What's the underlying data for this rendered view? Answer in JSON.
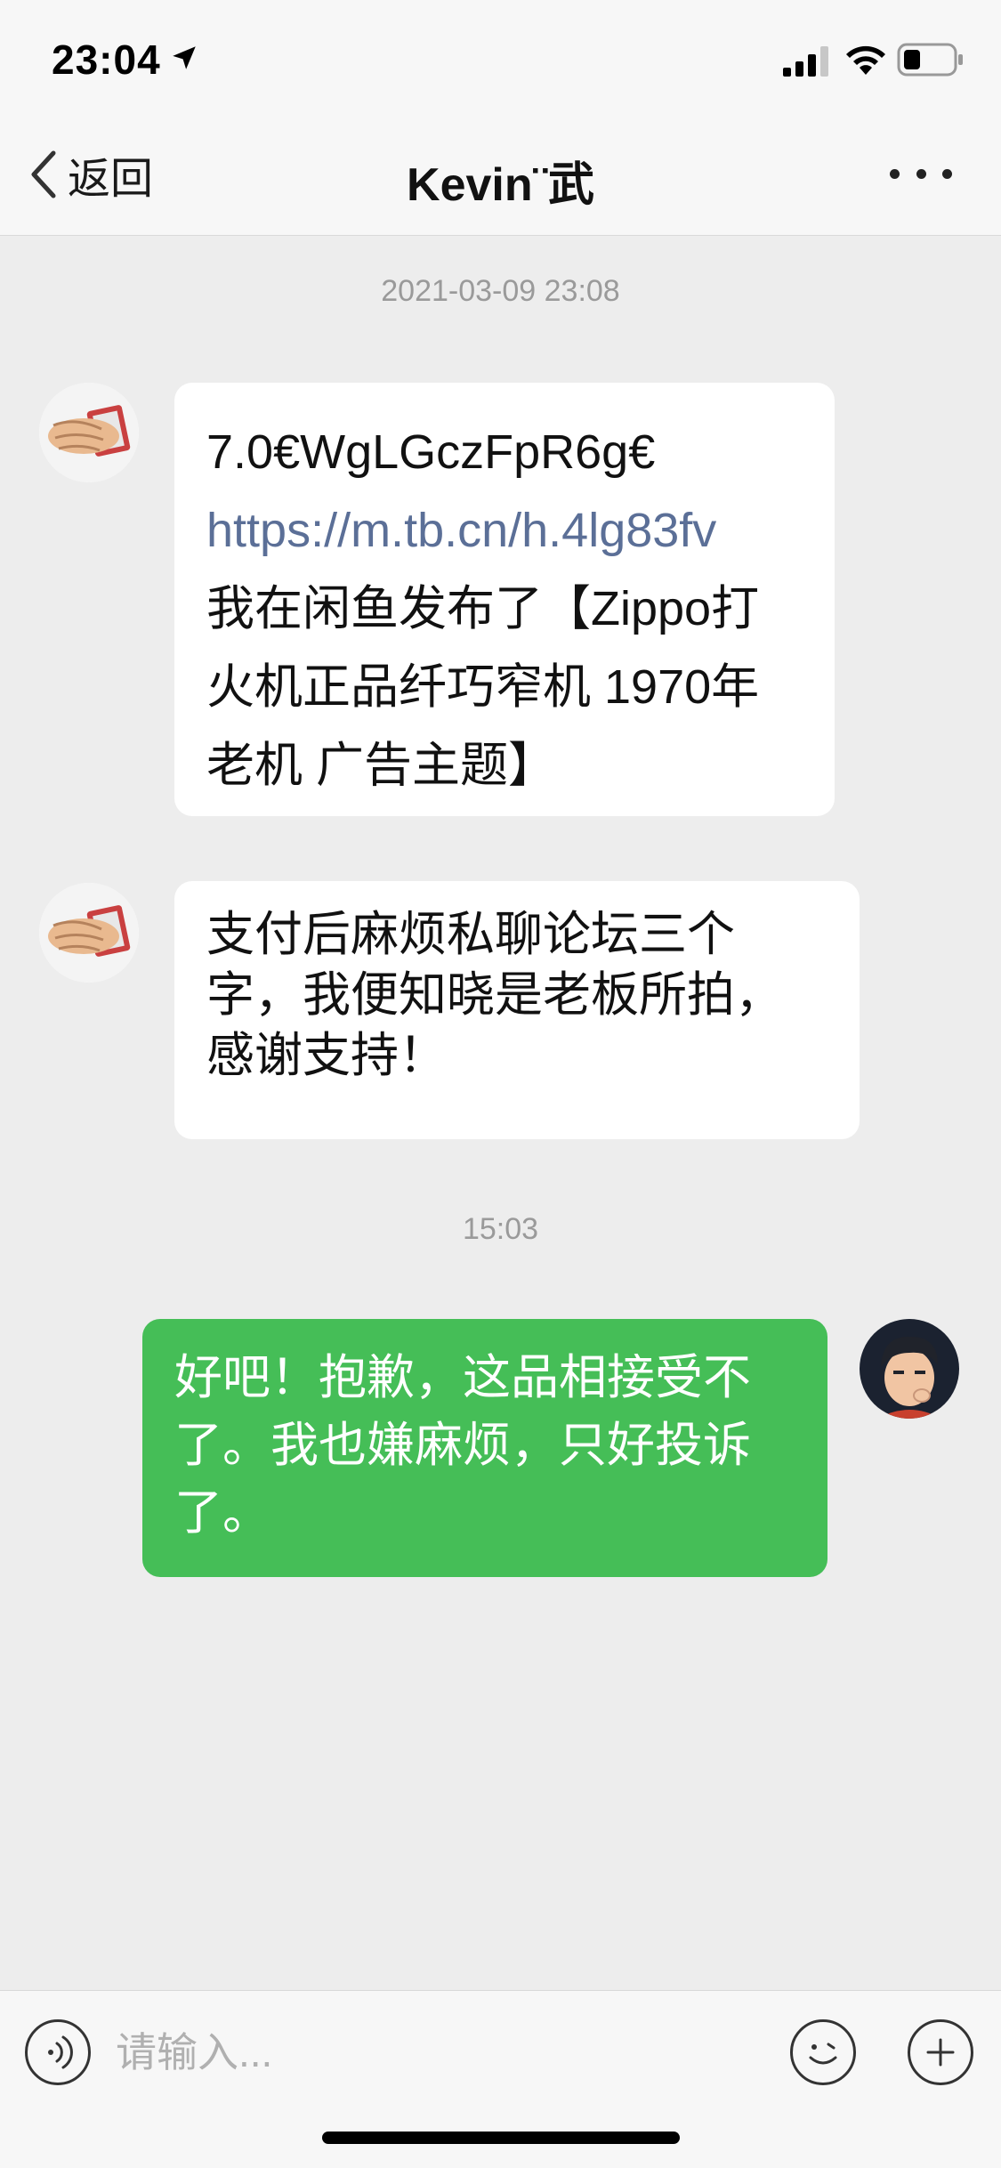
{
  "status_bar": {
    "time": "23:04"
  },
  "nav": {
    "back_label": "返回",
    "title": "Kevin¨武"
  },
  "chat": {
    "timestamp_1": "2021-03-09 23:08",
    "msg1": {
      "line1": "7.0€WgLGczFpR6g€",
      "link": "https://m.tb.cn/h.4lg83fv",
      "line3": "我在闲鱼发布了【Zippo打",
      "line4": "火机正品纤巧窄机 1970年",
      "line5": "老机 广告主题】"
    },
    "msg2": {
      "line1": "支付后麻烦私聊论坛三个",
      "line2": "字，我便知晓是老板所拍，",
      "line3": "感谢支持！"
    },
    "timestamp_2": "15:03",
    "msg3": {
      "line1": "好吧！抱歉，这品相接受不",
      "line2": "了。我也嫌麻烦，只好投诉",
      "line3": "了。"
    }
  },
  "input": {
    "placeholder": "请输入..."
  },
  "colors": {
    "outgoing_bubble": "#45be57",
    "incoming_bubble": "#ffffff",
    "background": "#ededed",
    "link": "#5b6f97"
  }
}
